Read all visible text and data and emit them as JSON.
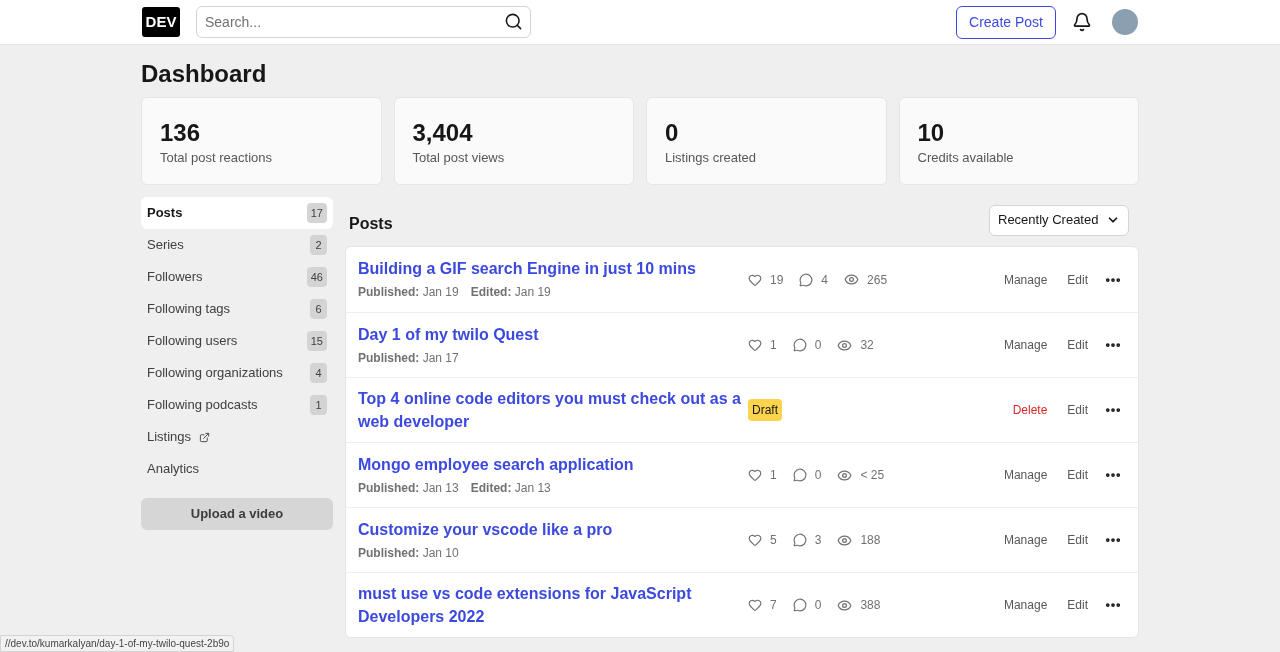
{
  "header": {
    "logo": "DEV",
    "search": {
      "placeholder": "Search..."
    },
    "create_button": "Create Post"
  },
  "title": "Dashboard",
  "stats": [
    {
      "value": "136",
      "label": "Total post reactions"
    },
    {
      "value": "3,404",
      "label": "Total post views"
    },
    {
      "value": "0",
      "label": "Listings created"
    },
    {
      "value": "10",
      "label": "Credits available"
    }
  ],
  "sidebar": {
    "items": [
      {
        "label": "Posts",
        "count": "17",
        "selected": true,
        "external": false
      },
      {
        "label": "Series",
        "count": "2",
        "selected": false,
        "external": false
      },
      {
        "label": "Followers",
        "count": "46",
        "selected": false,
        "external": false
      },
      {
        "label": "Following tags",
        "count": "6",
        "selected": false,
        "external": false
      },
      {
        "label": "Following users",
        "count": "15",
        "selected": false,
        "external": false
      },
      {
        "label": "Following organizations",
        "count": "4",
        "selected": false,
        "external": false
      },
      {
        "label": "Following podcasts",
        "count": "1",
        "selected": false,
        "external": false
      },
      {
        "label": "Listings",
        "selected": false,
        "external": true
      },
      {
        "label": "Analytics",
        "selected": false,
        "external": false
      }
    ],
    "upload_button": "Upload a video"
  },
  "posts": {
    "heading": "Posts",
    "sort": "Recently Created",
    "rows": [
      {
        "kind": "published",
        "title": "Building a GIF search Engine in just 10 mins",
        "meta": [
          {
            "label": "Published:",
            "value": "Jan 19"
          },
          {
            "label": "Edited:",
            "value": "Jan 19"
          }
        ],
        "reactions": "19",
        "comments": "4",
        "views": "265",
        "actions": [
          {
            "kind": "manage",
            "label": "Manage"
          },
          {
            "kind": "edit",
            "label": "Edit"
          }
        ]
      },
      {
        "kind": "published",
        "title": "Day 1 of my twilo Quest",
        "meta": [
          {
            "label": "Published:",
            "value": "Jan 17"
          }
        ],
        "reactions": "1",
        "comments": "0",
        "views": "32",
        "actions": [
          {
            "kind": "manage",
            "label": "Manage"
          },
          {
            "kind": "edit",
            "label": "Edit"
          }
        ]
      },
      {
        "kind": "draft",
        "title": "Top 4 online code editors you must check out as a web developer",
        "badge": "Draft",
        "actions": [
          {
            "kind": "delete",
            "label": "Delete"
          },
          {
            "kind": "edit",
            "label": "Edit"
          }
        ]
      },
      {
        "kind": "published",
        "title": "Mongo employee search application",
        "meta": [
          {
            "label": "Published:",
            "value": "Jan 13"
          },
          {
            "label": "Edited:",
            "value": "Jan 13"
          }
        ],
        "reactions": "1",
        "comments": "0",
        "views": "< 25",
        "actions": [
          {
            "kind": "manage",
            "label": "Manage"
          },
          {
            "kind": "edit",
            "label": "Edit"
          }
        ]
      },
      {
        "kind": "published",
        "title": "Customize your vscode like a pro",
        "meta": [
          {
            "label": "Published:",
            "value": "Jan 10"
          }
        ],
        "reactions": "5",
        "comments": "3",
        "views": "188",
        "actions": [
          {
            "kind": "manage",
            "label": "Manage"
          },
          {
            "kind": "edit",
            "label": "Edit"
          }
        ]
      },
      {
        "kind": "published",
        "title": "must use vs code extensions for JavaScript Developers 2022",
        "reactions": "7",
        "comments": "0",
        "views": "388",
        "actions": [
          {
            "kind": "manage",
            "label": "Manage"
          },
          {
            "kind": "edit",
            "label": "Edit"
          }
        ]
      }
    ]
  },
  "status_url": "//dev.to/kumarkalyan/day-1-of-my-twilo-quest-2b9o"
}
